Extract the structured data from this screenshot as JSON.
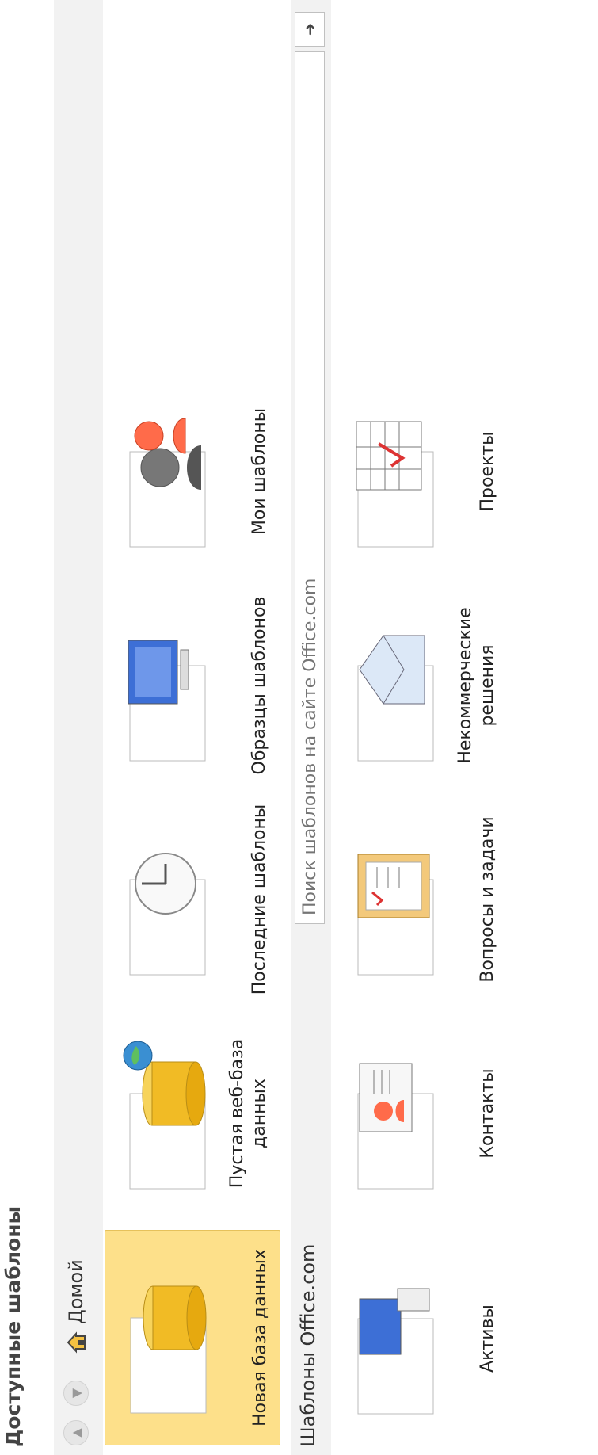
{
  "header": {
    "title": "Доступные шаблоны"
  },
  "nav": {
    "back_icon": "arrow-back-icon",
    "forward_icon": "arrow-forward-icon",
    "home_label": "Домой"
  },
  "tiles_top": [
    {
      "label": "Новая база данных",
      "icon": "database-icon",
      "selected": true
    },
    {
      "label": "Пустая веб-база данных",
      "icon": "web-database-icon",
      "selected": false
    },
    {
      "label": "Последние шаблоны",
      "icon": "clock-icon",
      "selected": false
    },
    {
      "label": "Образцы шаблонов",
      "icon": "computer-icon",
      "selected": false
    },
    {
      "label": "Мои шаблоны",
      "icon": "user-icon",
      "selected": false
    }
  ],
  "office": {
    "section_title": "Шаблоны Office.com",
    "search_placeholder": "Поиск шаблонов на сайте Office.com",
    "search_button_icon": "search-arrow-icon",
    "tiles": [
      {
        "label": "Активы",
        "icon": "assets-icon"
      },
      {
        "label": "Контакты",
        "icon": "contacts-icon"
      },
      {
        "label": "Вопросы и задачи",
        "icon": "issues-tasks-icon"
      },
      {
        "label": "Некоммерческие решения",
        "icon": "nonprofit-icon"
      },
      {
        "label": "Проекты",
        "icon": "projects-icon"
      }
    ]
  }
}
